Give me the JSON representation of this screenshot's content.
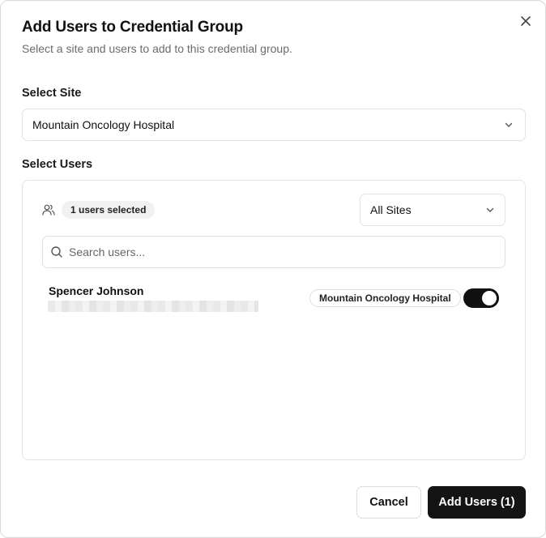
{
  "dialog": {
    "title": "Add Users to Credential Group",
    "subtitle": "Select a site and users to add to this credential group.",
    "close_icon": "x-icon"
  },
  "site_select": {
    "label": "Select Site",
    "value": "Mountain Oncology Hospital",
    "icon": "chevron-down-icon"
  },
  "users": {
    "label": "Select Users",
    "selected_badge": "1 users selected",
    "filter_value": "All Sites",
    "search_placeholder": "Search users...",
    "search_value": "",
    "list": [
      {
        "name": "Spencer Johnson",
        "site": "Mountain Oncology Hospital",
        "selected": true
      }
    ]
  },
  "footer": {
    "cancel_label": "Cancel",
    "add_label": "Add Users (1)"
  },
  "colors": {
    "primary": "#141414",
    "muted_text": "#6b6b6b",
    "border": "#e3e3e3",
    "badge_bg": "#f1f1f1"
  }
}
